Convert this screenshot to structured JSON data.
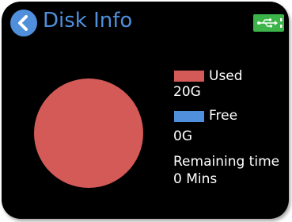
{
  "header": {
    "title": "Disk Info",
    "back_icon": "back-arrow-icon",
    "status_icon": "usb-connected-icon"
  },
  "colors": {
    "accent": "#4f8fdc",
    "used": "#d45a57",
    "free": "#4f8fdc",
    "usb_badge": "#3cb44a",
    "background": "#000000"
  },
  "chart_data": {
    "type": "pie",
    "categories": [
      "Used",
      "Free"
    ],
    "values": [
      20,
      0
    ],
    "unit": "G"
  },
  "legend": {
    "used_label": "Used",
    "used_value": "20G",
    "free_label": "Free",
    "free_value": "0G"
  },
  "remaining": {
    "label": "Remaining time",
    "value": "0 Mins"
  }
}
